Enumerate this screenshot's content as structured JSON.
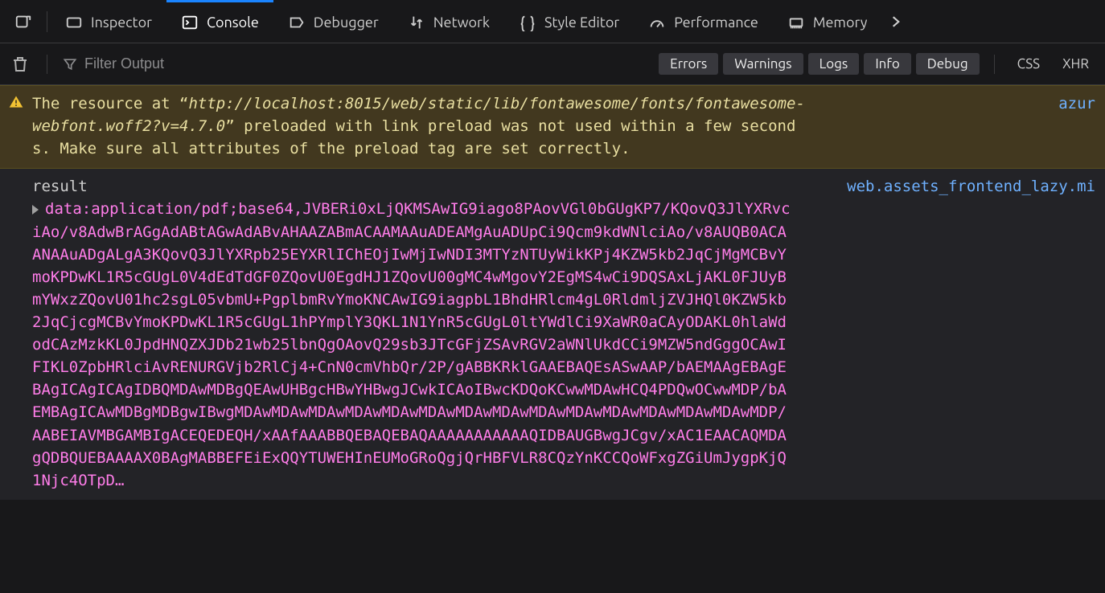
{
  "toolbar": {
    "tabs": [
      {
        "label": "Inspector"
      },
      {
        "label": "Console"
      },
      {
        "label": "Debugger"
      },
      {
        "label": "Network"
      },
      {
        "label": "Style Editor"
      },
      {
        "label": "Performance"
      },
      {
        "label": "Memory"
      }
    ]
  },
  "filterbar": {
    "placeholder": "Filter Output",
    "toggles": {
      "errors": "Errors",
      "warnings": "Warnings",
      "logs": "Logs",
      "info": "Info",
      "debug": "Debug"
    },
    "plain": {
      "css": "CSS",
      "xhr": "XHR"
    }
  },
  "console": {
    "warning": {
      "pre": "The resource at “",
      "url": "http://localhost:8015/web/static/lib/fontawesome/fonts/fontawesome-webfont.woff2?v=4.7.0",
      "post": "” preloaded with link preload was not used within a few seconds. Make sure all attributes of the preload tag are set correctly.",
      "source": "azur"
    },
    "log": {
      "label": "result",
      "data": "data:application/pdf;base64,JVBERi0xLjQKMSAwIG9iago8PAovVGl0bGUgKP7/KQovQ3JlYXRvciAo/v8AdwBrAGgAdABtAGwAdABvAHAAZABmACAAMAAuADEAMgAuADUpCi9Qcm9kdWNlciAo/v8AUQB0ACAANAAuADgALgA3KQovQ3JlYXRpb25EYXRlIChEOjIwMjIwNDI3MTYzNTUyWikKPj4KZW5kb2JqCjMgMCBvYmoKPDwKL1R5cGUgL0V4dEdTdGF0ZQovU0EgdHJ1ZQovU00gMC4wMgovY2EgMS4wCi9DQSAxLjAKL0FJUyBmYWxzZQovU01hc2sgL05vbmU+PgplbmRvYmoKNCAwIG9iagpbL1BhdHRlcm4gL0RldmljZVJHQl0KZW5kb2JqCjcgMCBvYmoKPDwKL1R5cGUgL1hPYmplY3QKL1N1YnR5cGUgL0ltYWdlCi9XaWR0aCAyODAKL0hlaWdodCAzMzkKL0JpdHNQZXJDb21wb25lbnQgOAovQ29sb3JTcGFjZSAvRGV2aWNlUkdCCi9MZW5ndGggOCAwIFIKL0ZpbHRlciAvRENURGVjb2RlCj4+CnN0cmVhbQr/2P/gABBKRklGAAEBAQEsASwAAP/bAEMAAgEBAgEBAgICAgICAgIDBQMDAwMDBgQEAwUHBgcHBwYHBwgJCwkICAoIBwcKDQoKCwwMDAwHCQ4PDQwOCwwMDP/bAEMBAgICAwMDBgMDBgwIBwgMDAwMDAwMDAwMDAwMDAwMDAwMDAwMDAwMDAwMDAwMDAwMDAwMDAwMDAwMDP/AABEIAVMBGAMBIgACEQEDEQH/xAAfAAABBQEBAQEBAQAAAAAAAAAAAQIDBAUGBwgJCgv/xAC1EAACAQMDAgQDBQUEBAAAAX0BAgMABBEFEiExQQYTUWEHInEUMoGRoQgjQrHBFVLR8CQzYnKCCQoWFxgZGiUmJygpKjQ1Njc4OTpD…",
      "source": "web.assets_frontend_lazy.mi"
    }
  }
}
